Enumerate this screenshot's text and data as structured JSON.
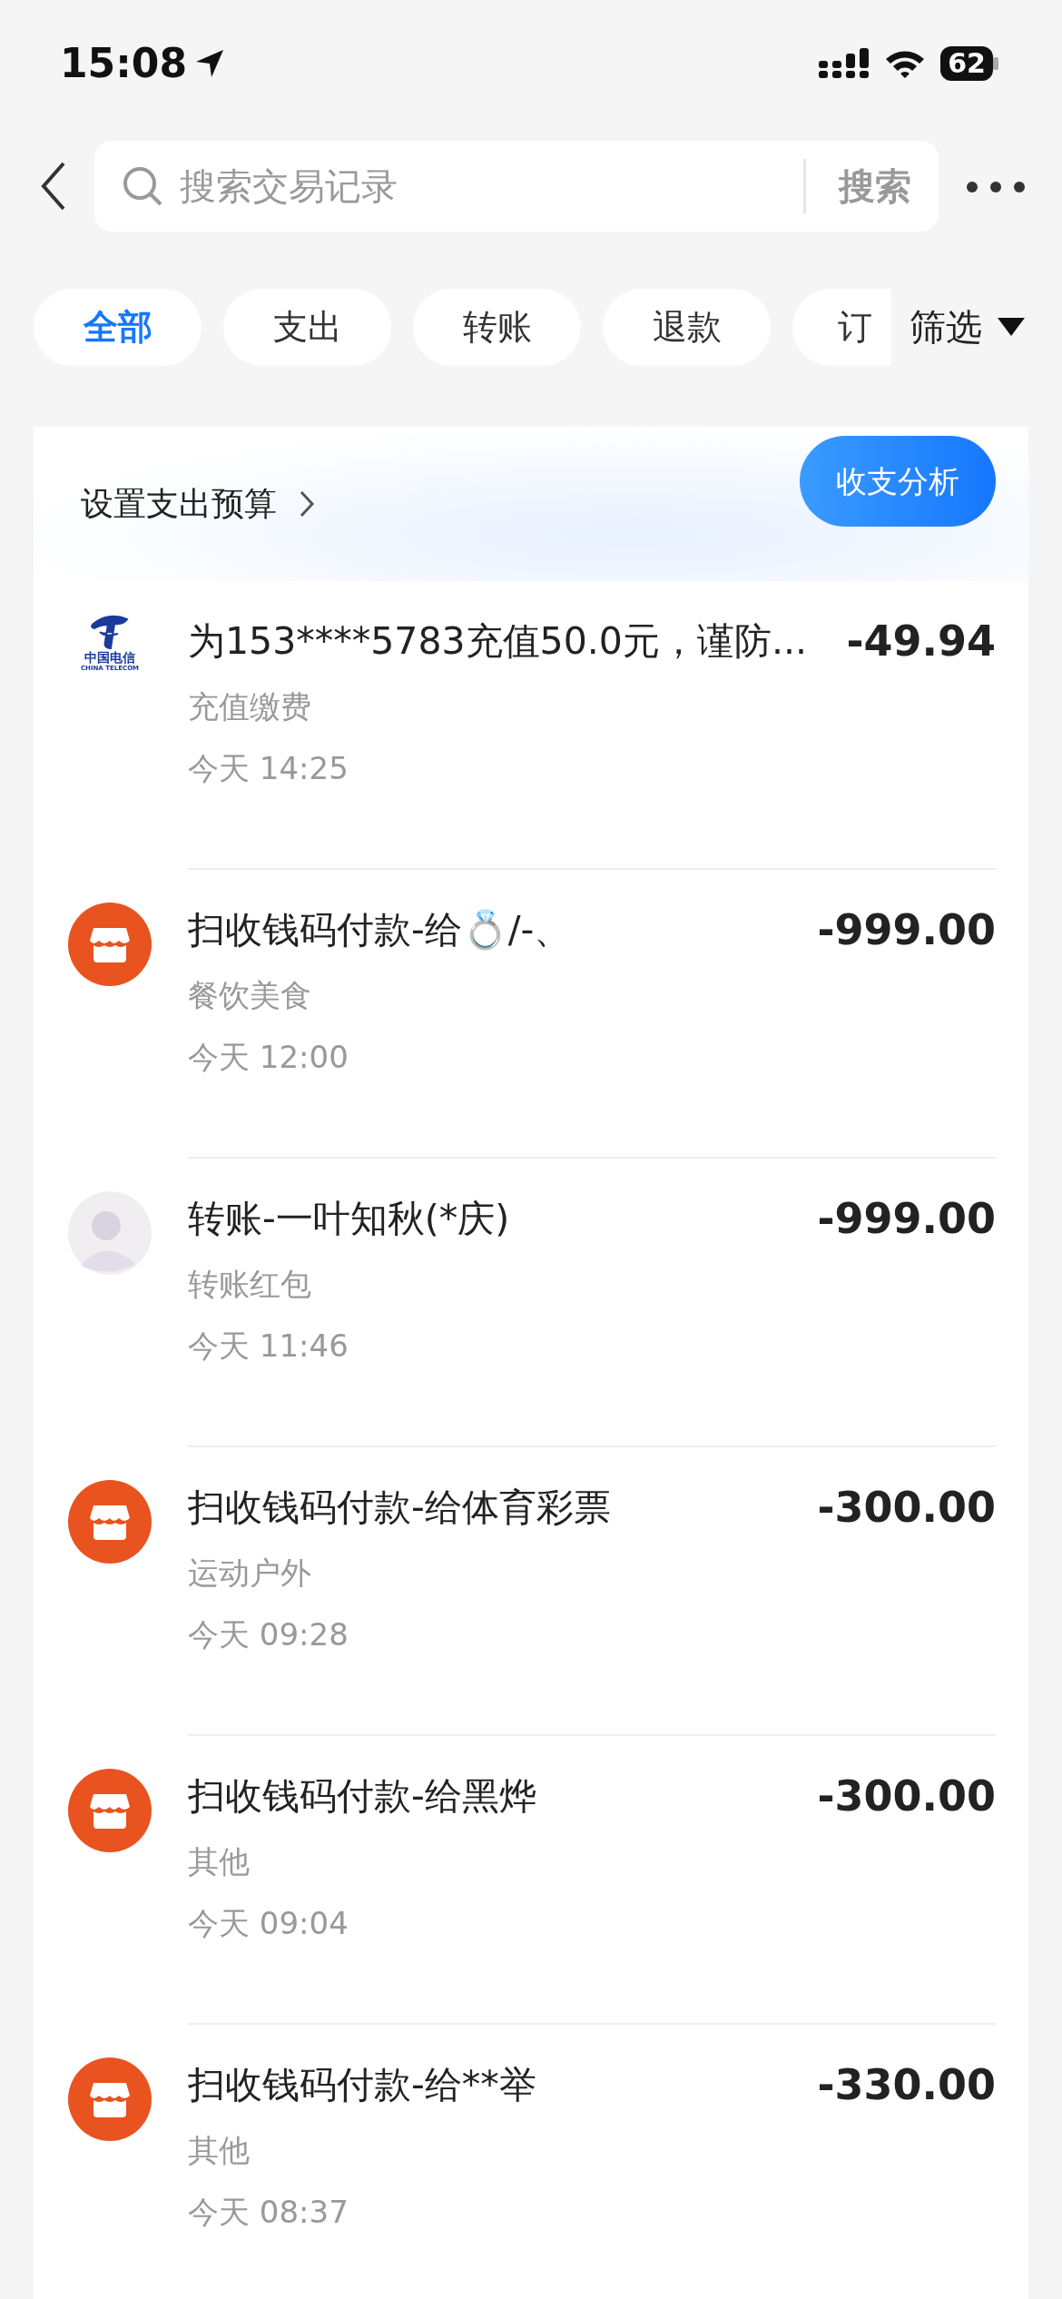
{
  "status_bar": {
    "time": "15:08",
    "battery": "62"
  },
  "search": {
    "placeholder": "搜索交易记录",
    "button": "搜索"
  },
  "filters": [
    {
      "label": "全部",
      "selected": true
    },
    {
      "label": "支出",
      "selected": false
    },
    {
      "label": "转账",
      "selected": false
    },
    {
      "label": "退款",
      "selected": false
    },
    {
      "label": "订",
      "selected": false
    }
  ],
  "filter_menu": "筛选",
  "budget": {
    "label": "设置支出预算",
    "analysis_button": "收支分析"
  },
  "transactions": [
    {
      "kind": "telecom",
      "logo_text": "中国电信",
      "logo_subtext": "CHINA TELECOM",
      "title": "为153****5783充值50.0元，谨防...",
      "category": "充值缴费",
      "time": "今天 14:25",
      "amount": "-49.94"
    },
    {
      "kind": "store",
      "title": "扫收钱码付款-给💍/-、",
      "category": "餐饮美食",
      "time": "今天 12:00",
      "amount": "-999.00"
    },
    {
      "kind": "avatar",
      "title": "转账-一叶知秋(*庆)",
      "category": "转账红包",
      "time": "今天 11:46",
      "amount": "-999.00"
    },
    {
      "kind": "store",
      "title": "扫收钱码付款-给体育彩票",
      "category": "运动户外",
      "time": "今天 09:28",
      "amount": "-300.00"
    },
    {
      "kind": "store",
      "title": "扫收钱码付款-给黑烨",
      "category": "其他",
      "time": "今天 09:04",
      "amount": "-300.00"
    },
    {
      "kind": "store",
      "title": "扫收钱码付款-给**举",
      "category": "其他",
      "time": "今天 08:37",
      "amount": "-330.00"
    }
  ]
}
